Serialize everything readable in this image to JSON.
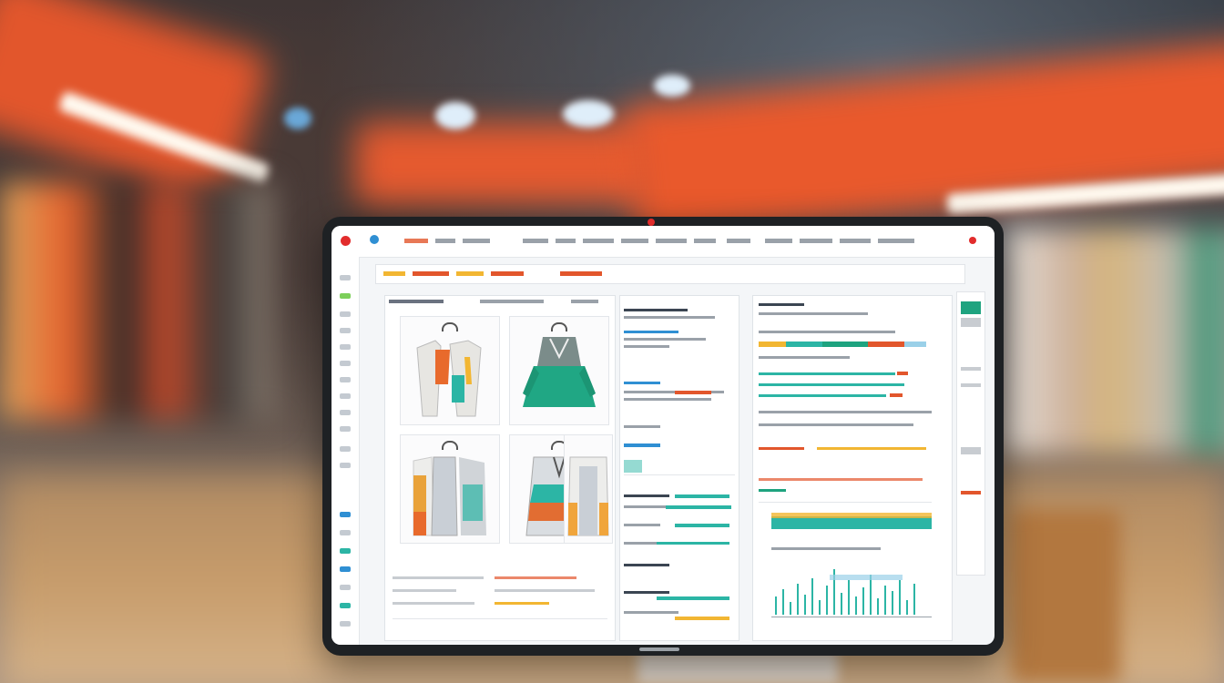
{
  "scene": {
    "description_colors": {
      "banner": "#e9592c",
      "floor": "#c79c6b",
      "tablet_frame": "#1e2124"
    }
  },
  "app": {
    "brand_text": "",
    "nav_items": [
      "",
      "",
      "",
      "",
      "",
      "",
      "",
      ""
    ],
    "colors": {
      "accent": "#e2562c",
      "teal": "#2cb5a5",
      "blue": "#2f8fd3",
      "green": "#1ea37f"
    }
  },
  "workspace": {
    "breadcrumb": "",
    "panel_titles": [
      "",
      "",
      ""
    ]
  },
  "garments": [
    {
      "name": "orange-white-coat-set",
      "primary": "#e86a2c",
      "secondary": "#e7e6e2"
    },
    {
      "name": "green-pleated-dress",
      "primary": "#20a784",
      "secondary": "#7b8c8a"
    },
    {
      "name": "colorblock-cardigan",
      "primary": "#e9a23a",
      "secondary": "#c9cfd6"
    },
    {
      "name": "teal-orange-jacket",
      "primary": "#2cb5a5",
      "secondary": "#e26d32"
    },
    {
      "name": "white-orange-coat",
      "primary": "#f0a53c",
      "secondary": "#ededeb"
    }
  ],
  "chart_colors": [
    "#2cb5a5",
    "#e2562c",
    "#f2b632",
    "#2f8fd3"
  ]
}
